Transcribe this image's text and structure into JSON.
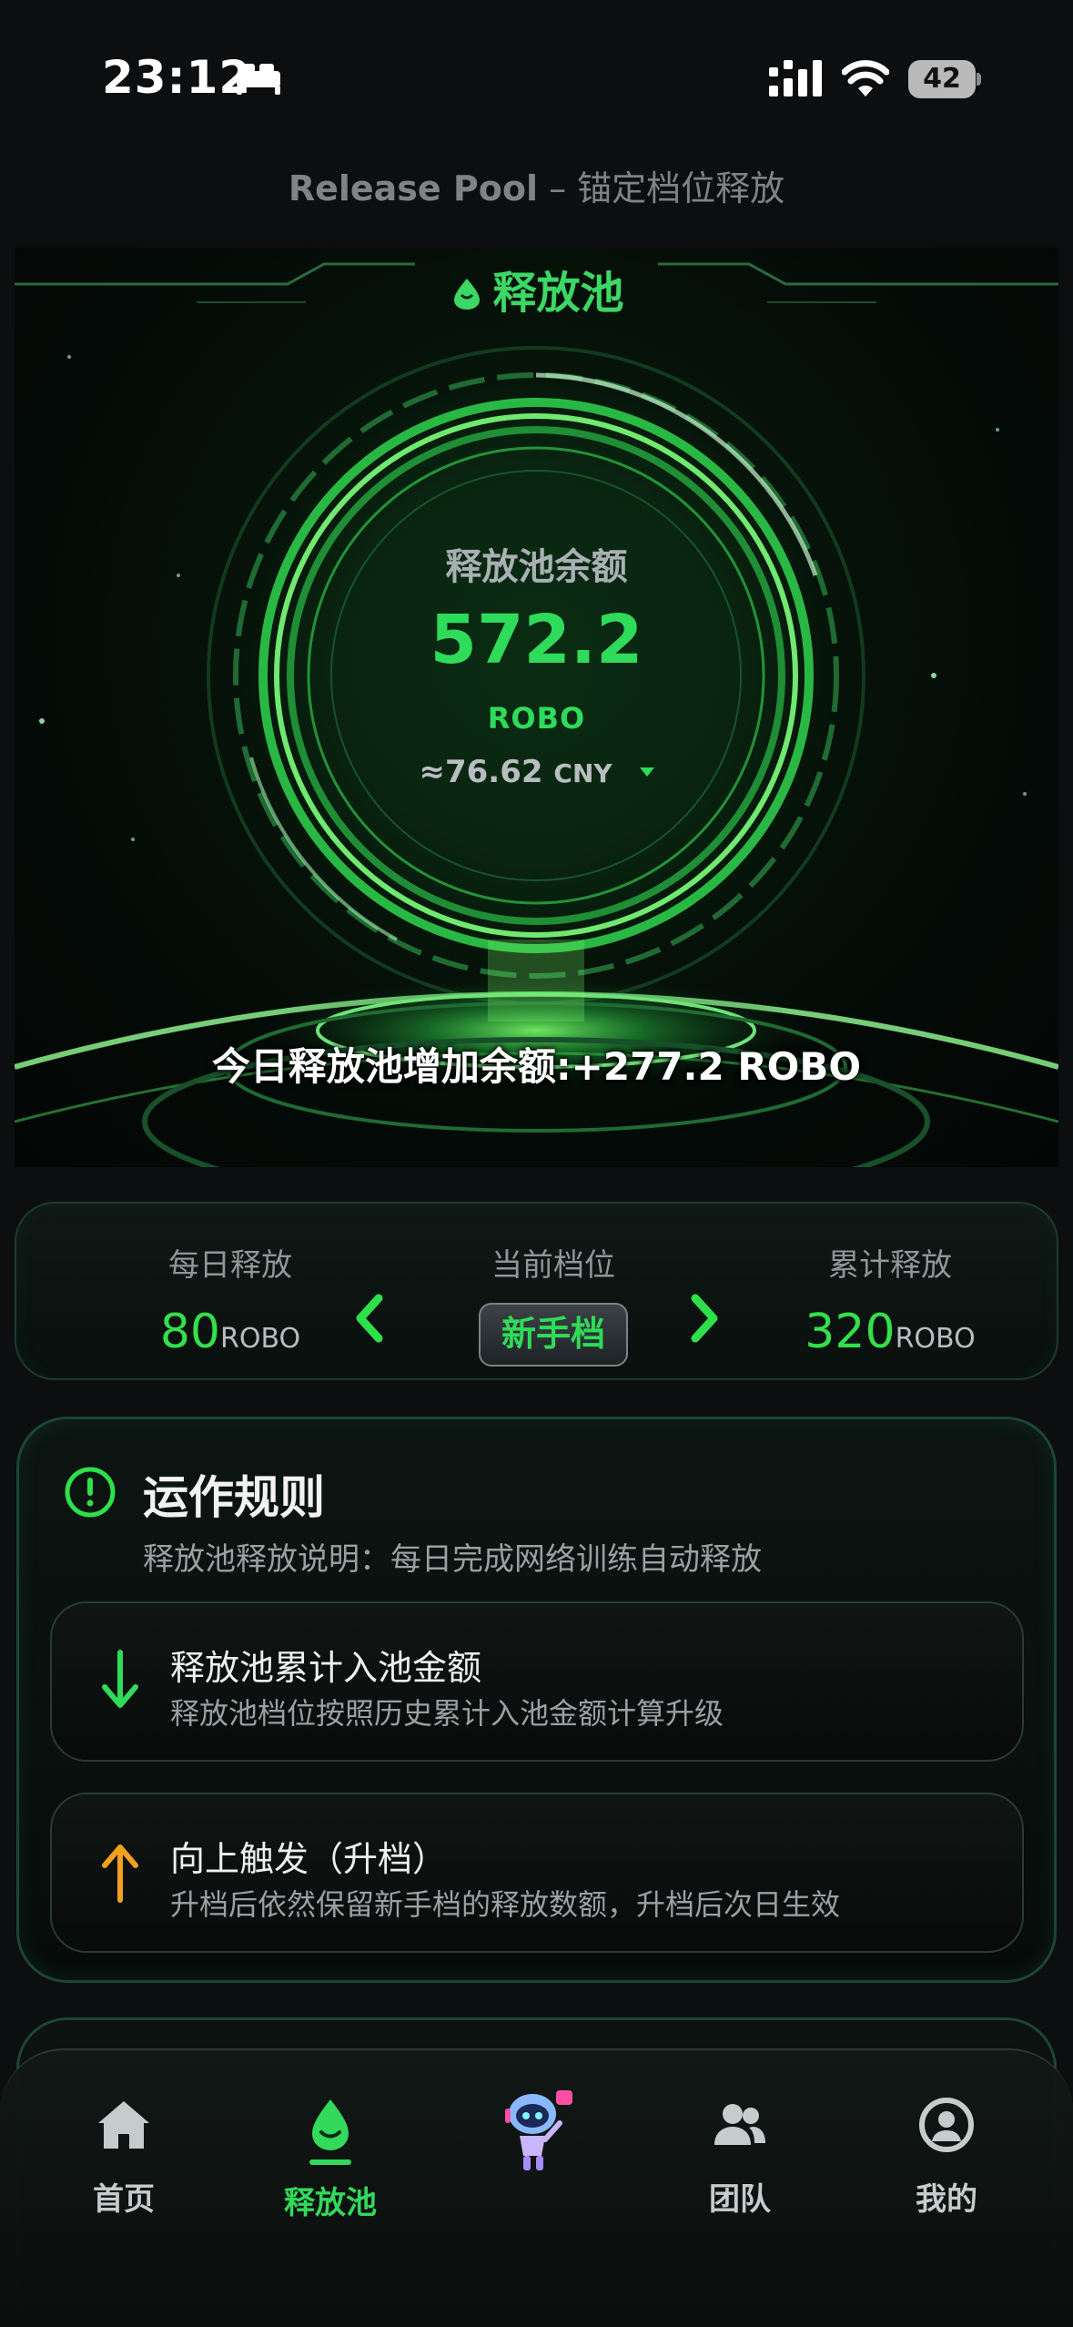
{
  "status_bar": {
    "time": "23:12",
    "battery": "42"
  },
  "header": {
    "title_en": "Release Pool",
    "title_sep": " – ",
    "title_cn": "锚定档位释放"
  },
  "hero": {
    "badge": "释放池",
    "balance_label": "释放池余额",
    "balance_value": "572.2",
    "balance_unit": "ROBO",
    "cny_value": "≈76.62",
    "cny_unit": "CNY",
    "today_add": "今日释放池增加余额:+277.2 ROBO"
  },
  "level": {
    "daily_label": "每日释放",
    "daily_value": "80",
    "daily_unit": "ROBO",
    "current_label": "当前档位",
    "current_value": "新手档",
    "total_label": "累计释放",
    "total_value": "320",
    "total_unit": "ROBO"
  },
  "rules": {
    "title": "运作规则",
    "desc": "释放池释放说明：每日完成网络训练自动释放",
    "items": [
      {
        "title": "释放池累计入池金额",
        "desc": "释放池档位按照历史累计入池金额计算升级",
        "icon": "arrow-down-icon",
        "color": "#2edb5a"
      },
      {
        "title": "向上触发（升档）",
        "desc": "升档后依然保留新手档的释放数额，升档后次日生效",
        "icon": "arrow-up-icon",
        "color": "#f2a01e"
      }
    ]
  },
  "tabs": [
    {
      "label": "首页",
      "icon": "home-icon"
    },
    {
      "label": "释放池",
      "icon": "drop-icon",
      "active": true
    },
    {
      "label": "",
      "icon": "robot-icon"
    },
    {
      "label": "团队",
      "icon": "team-icon"
    },
    {
      "label": "我的",
      "icon": "user-icon"
    }
  ],
  "colors": {
    "accent": "#2edb5a",
    "background": "#0c0e0f"
  }
}
